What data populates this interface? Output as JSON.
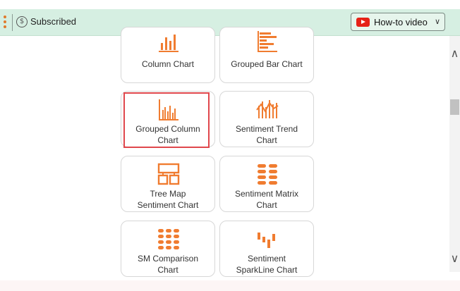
{
  "header": {
    "status_label": "Subscribed",
    "howto_label": "How-to video"
  },
  "colors": {
    "accent": "#f07c30",
    "selected_border": "#e0474c",
    "topbar": "#d6efe2"
  },
  "cards": [
    {
      "label_lines": [
        "Column Chart"
      ],
      "icon": "column-chart-icon"
    },
    {
      "label_lines": [
        "Grouped Bar Chart"
      ],
      "icon": "grouped-bar-chart-icon"
    },
    {
      "label_lines": [
        "Grouped Column",
        "Chart"
      ],
      "icon": "grouped-column-chart-icon",
      "selected": true
    },
    {
      "label_lines": [
        "Sentiment Trend",
        "Chart"
      ],
      "icon": "sentiment-trend-chart-icon"
    },
    {
      "label_lines": [
        "Tree Map",
        "Sentiment Chart"
      ],
      "icon": "tree-map-icon"
    },
    {
      "label_lines": [
        "Sentiment Matrix",
        "Chart"
      ],
      "icon": "sentiment-matrix-icon"
    },
    {
      "label_lines": [
        "SM Comparison",
        "Chart"
      ],
      "icon": "sm-comparison-icon"
    },
    {
      "label_lines": [
        "Sentiment",
        "SparkLine Chart"
      ],
      "icon": "sparkline-chart-icon"
    }
  ]
}
